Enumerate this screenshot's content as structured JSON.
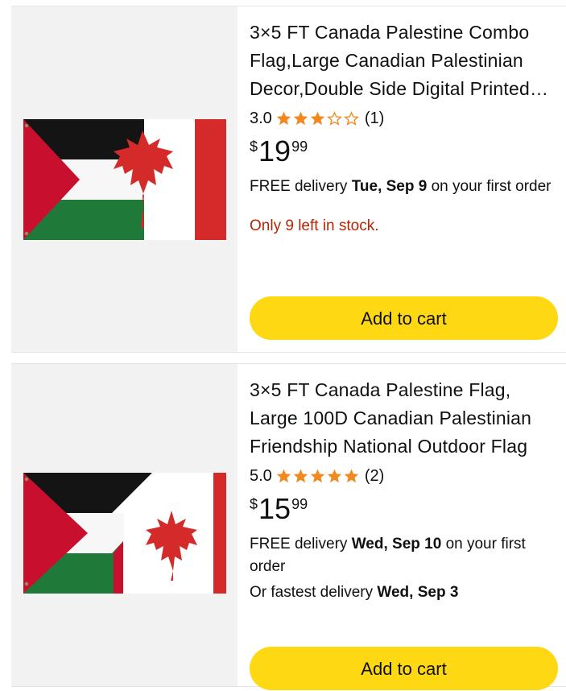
{
  "products": [
    {
      "title": "3×5 FT Canada Palestine Combo Flag,Large Canadian Palestinian Decor,Double Side Digital Printed Flag",
      "rating": "3.0",
      "stars_filled": 3,
      "review_count": "(1)",
      "price_symbol": "$",
      "price_whole": "19",
      "price_fraction": "99",
      "delivery_prefix": "FREE delivery ",
      "delivery_date": "Tue, Sep 9",
      "delivery_suffix": " on your first order",
      "stock_note": "Only 9 left in stock.",
      "cart_label": "Add to cart"
    },
    {
      "title": "3×5 FT Canada Palestine Flag, Large 100D Canadian Palestinian Friendship National Outdoor Flag",
      "rating": "5.0",
      "stars_filled": 5,
      "review_count": "(2)",
      "price_symbol": "$",
      "price_whole": "15",
      "price_fraction": "99",
      "delivery_prefix": "FREE delivery ",
      "delivery_date": "Wed, Sep 10",
      "delivery_suffix": " on your first order",
      "fastest_prefix": "Or fastest delivery ",
      "fastest_date": "Wed, Sep 3",
      "cart_label": "Add to cart"
    }
  ],
  "colors": {
    "star": "#f2891e",
    "button": "#ffd814",
    "stock_warning": "#b12704",
    "image_bg": "#f2f2f2"
  }
}
